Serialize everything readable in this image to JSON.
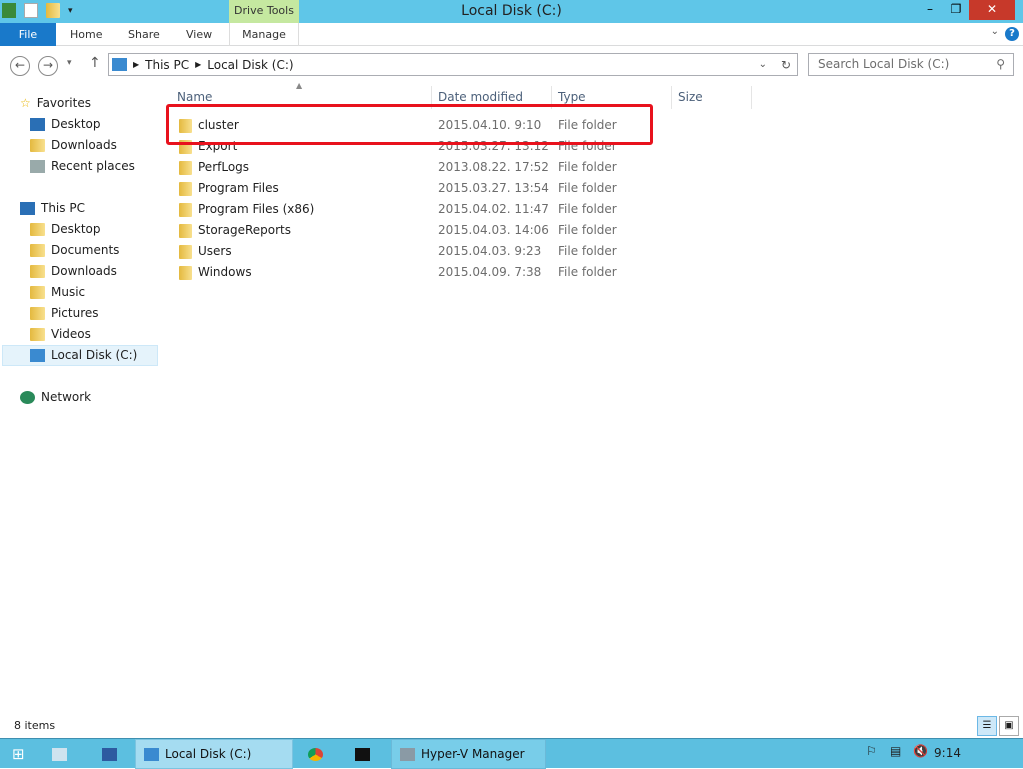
{
  "window": {
    "title": "Local Disk (C:)",
    "context_tab": "Drive Tools"
  },
  "ribbon": {
    "tabs": [
      "File",
      "Home",
      "Share",
      "View",
      "Manage"
    ]
  },
  "nav": {
    "breadcrumb": [
      "This PC",
      "Local Disk (C:)"
    ],
    "search_placeholder": "Search Local Disk (C:)"
  },
  "sidebar": {
    "favorites": {
      "label": "Favorites",
      "items": [
        "Desktop",
        "Downloads",
        "Recent places"
      ]
    },
    "this_pc": {
      "label": "This PC",
      "items": [
        "Desktop",
        "Documents",
        "Downloads",
        "Music",
        "Pictures",
        "Videos",
        "Local Disk (C:)"
      ],
      "selected": "Local Disk (C:)"
    },
    "network": {
      "label": "Network"
    }
  },
  "columns": [
    "Name",
    "Date modified",
    "Type",
    "Size"
  ],
  "files": [
    {
      "name": "cluster",
      "date": "2015.04.10. 9:10",
      "type": "File folder"
    },
    {
      "name": "Export",
      "date": "2015.03.27. 13:12",
      "type": "File folder"
    },
    {
      "name": "PerfLogs",
      "date": "2013.08.22. 17:52",
      "type": "File folder"
    },
    {
      "name": "Program Files",
      "date": "2015.03.27. 13:54",
      "type": "File folder"
    },
    {
      "name": "Program Files (x86)",
      "date": "2015.04.02. 11:47",
      "type": "File folder"
    },
    {
      "name": "StorageReports",
      "date": "2015.04.03. 14:06",
      "type": "File folder"
    },
    {
      "name": "Users",
      "date": "2015.04.03. 9:23",
      "type": "File folder"
    },
    {
      "name": "Windows",
      "date": "2015.04.09. 7:38",
      "type": "File folder"
    }
  ],
  "highlight_color": "#e8121d",
  "status": {
    "items": "8 items"
  },
  "taskbar": {
    "local_disk": "Local Disk (C:)",
    "hyperv": "Hyper-V Manager",
    "clock": "9:14"
  }
}
